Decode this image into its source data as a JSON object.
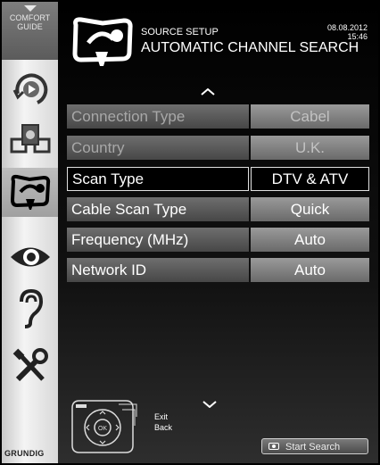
{
  "sidebar": {
    "comfort_line1": "COMFORT",
    "comfort_line2": "GUIDE",
    "icons": [
      "playback-icon",
      "source-devices-icon",
      "source-setup-icon",
      "picture-eye-icon",
      "sound-ear-icon",
      "tools-icon"
    ],
    "brand": "GRUNDIG"
  },
  "header": {
    "subtitle": "SOURCE SETUP",
    "title": "AUTOMATIC CHANNEL SEARCH",
    "date": "08.08.2012",
    "time": "15:46"
  },
  "rows": [
    {
      "label": "Connection Type",
      "value": "Cabel",
      "state": "disabled"
    },
    {
      "label": "Country",
      "value": "U.K.",
      "state": "disabled"
    },
    {
      "label": "Scan Type",
      "value": "DTV & ATV",
      "state": "selected"
    },
    {
      "label": "Cable Scan Type",
      "value": "Quick",
      "state": "normal"
    },
    {
      "label": "Frequency (MHz)",
      "value": "Auto",
      "state": "normal"
    },
    {
      "label": "Network ID",
      "value": "Auto",
      "state": "normal"
    }
  ],
  "footer": {
    "ok": "OK",
    "exit": "Exit",
    "back": "Back",
    "start_search": "Start Search"
  }
}
